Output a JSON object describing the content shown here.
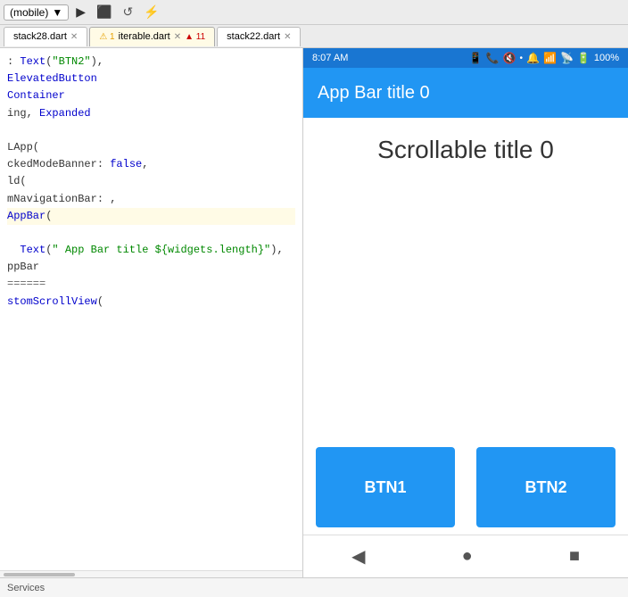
{
  "ide": {
    "device_selector": "(mobile)",
    "tabs": [
      {
        "label": "stack28.dart",
        "active": false,
        "closable": true
      },
      {
        "label": "iterable.dart",
        "active": true,
        "closable": true
      },
      {
        "label": "stack22.dart",
        "active": false,
        "closable": true
      }
    ],
    "warning": "⚠ 1",
    "error": "▲ 11"
  },
  "code": {
    "lines": [
      {
        "text": ": Text(\"BTN2\"),",
        "highlight": false
      },
      {
        "text": "ElevatedButton",
        "highlight": false
      },
      {
        "text": "Container",
        "highlight": false
      },
      {
        "text": "ing, Expanded",
        "highlight": false
      },
      {
        "text": "",
        "highlight": false
      },
      {
        "text": "LApp(",
        "highlight": false
      },
      {
        "text": "ckedModeBanner: false,",
        "highlight": false
      },
      {
        "text": "ld(",
        "highlight": false
      },
      {
        "text": "mNavigationBar: ,",
        "highlight": false
      },
      {
        "text": "AppBar(",
        "highlight": true
      },
      {
        "text": "  Text(\" App Bar title ${widgets.length}\"),",
        "highlight": false
      },
      {
        "text": "ppBar",
        "highlight": false
      },
      {
        "text": "======",
        "highlight": false
      },
      {
        "text": "stomScrollView(",
        "highlight": false
      }
    ]
  },
  "phone": {
    "status_bar": {
      "time": "8:07 AM",
      "battery": "100%"
    },
    "app_bar_title": "App Bar title 0",
    "scrollable_title": "Scrollable title 0",
    "btn1_label": "BTN1",
    "btn2_label": "BTN2",
    "bottom_nav_icons": [
      "◀",
      "●",
      "■"
    ]
  },
  "services_bar": {
    "label": "Services"
  }
}
